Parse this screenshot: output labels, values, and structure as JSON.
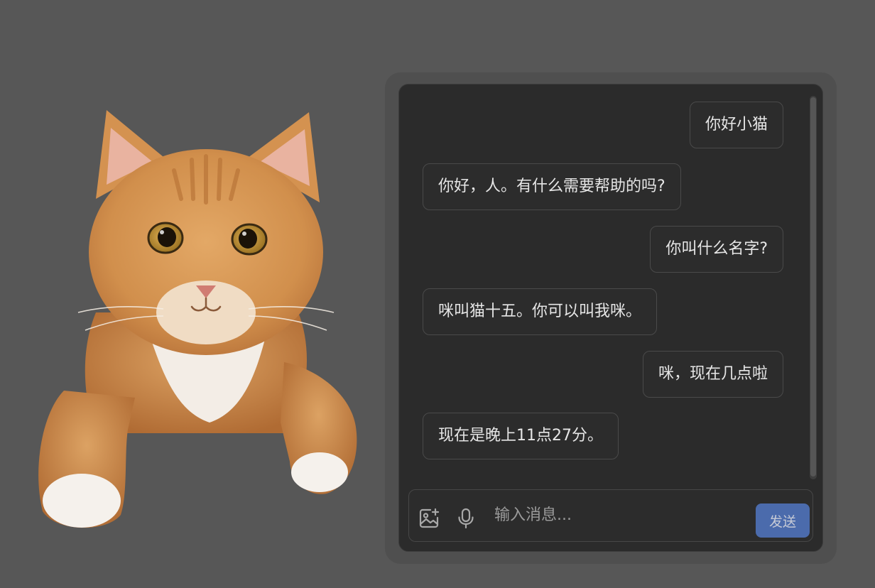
{
  "chat": {
    "messages": [
      {
        "role": "user",
        "text": "你好小猫"
      },
      {
        "role": "assistant",
        "text": "你好，人。有什么需要帮助的吗?"
      },
      {
        "role": "user",
        "text": "你叫什么名字?"
      },
      {
        "role": "assistant",
        "text": "咪叫猫十五。你可以叫我咪。"
      },
      {
        "role": "user",
        "text": "咪，现在几点啦"
      },
      {
        "role": "assistant",
        "text": "现在是晚上11点27分。"
      }
    ]
  },
  "input": {
    "placeholder": "输入消息...",
    "value": "",
    "image_icon": "image-add-icon",
    "mic_icon": "microphone-icon",
    "send_label": "发送"
  },
  "colors": {
    "page_background": "#575757",
    "panel_background": "#2b2b2b",
    "bubble_border": "#4a4a4a",
    "text": "#e6e6e6",
    "send_button": "#4b6bac"
  },
  "illustration": {
    "subject": "orange-tabby-cat"
  }
}
